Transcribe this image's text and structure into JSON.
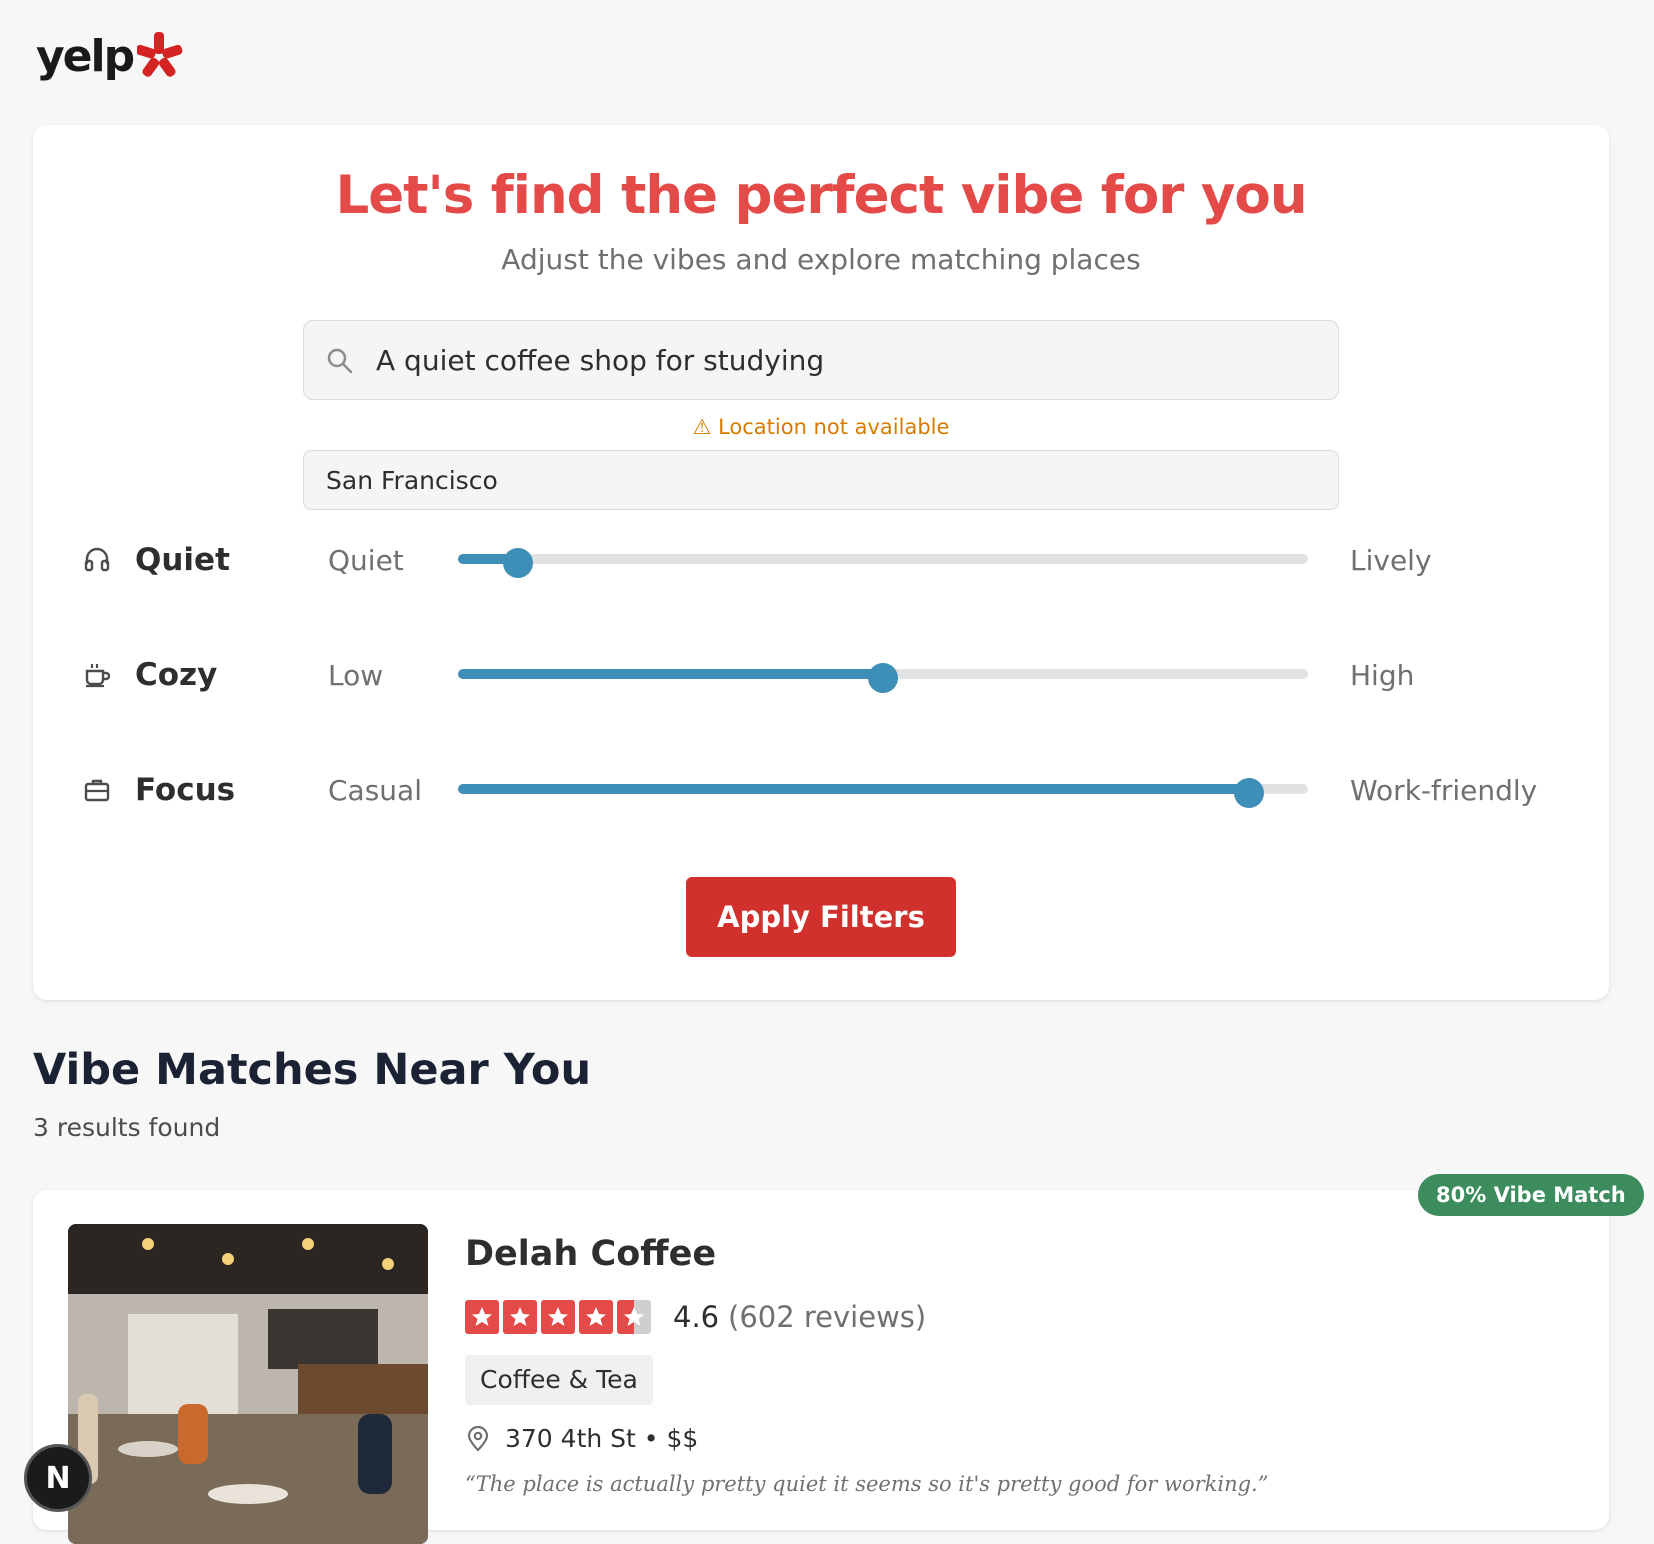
{
  "brand": {
    "name": "yelp",
    "color": "#d32323"
  },
  "hero": {
    "title": "Let's find the perfect vibe for you",
    "subtitle": "Adjust the vibes and explore matching places"
  },
  "search": {
    "query": "A quiet coffee shop for studying",
    "icon": "search-icon",
    "location_warning": "⚠ Location not available",
    "city": "San Francisco"
  },
  "vibes": [
    {
      "name": "Quiet",
      "icon": "headphones-icon",
      "low_label": "Quiet",
      "high_label": "Lively",
      "value": 0.07
    },
    {
      "name": "Cozy",
      "icon": "coffee-cup-icon",
      "low_label": "Low",
      "high_label": "High",
      "value": 0.5
    },
    {
      "name": "Focus",
      "icon": "briefcase-icon",
      "low_label": "Casual",
      "high_label": "Work-friendly",
      "value": 0.93
    }
  ],
  "apply_button": "Apply Filters",
  "results": {
    "title": "Vibe Matches Near You",
    "count_text": "3 results found",
    "items": [
      {
        "match": "80% Vibe Match",
        "name": "Delah Coffee",
        "rating": "4.6",
        "rating_value": 4.6,
        "reviews": "(602 reviews)",
        "category": "Coffee & Tea",
        "address": "370 4th St • $$",
        "quote": "“The place is actually pretty quiet it seems so it's pretty good for working.”"
      }
    ]
  },
  "dev_badge": "N",
  "colors": {
    "accent": "#e34a48",
    "slider": "#3e8fb7",
    "button": "#d0312c",
    "warning": "#d67b00",
    "match_badge": "#3d8c5e"
  }
}
